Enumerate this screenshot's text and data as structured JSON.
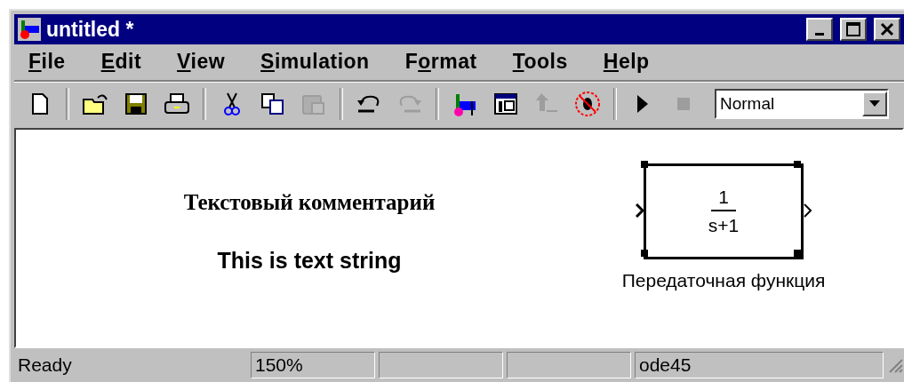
{
  "window": {
    "title": "untitled *"
  },
  "menu": [
    {
      "mnemonic": "F",
      "after": "ile"
    },
    {
      "mnemonic": "E",
      "after": "dit"
    },
    {
      "mnemonic": "V",
      "after": "iew"
    },
    {
      "mnemonic": "S",
      "after": "imulation"
    },
    {
      "before": "F",
      "mnemonic": "o",
      "after": "rmat"
    },
    {
      "mnemonic": "T",
      "after": "ools"
    },
    {
      "mnemonic": "H",
      "after": "elp"
    }
  ],
  "toolbar": [
    {
      "kind": "new",
      "disabled": false
    },
    {
      "kind": "sep"
    },
    {
      "kind": "open",
      "disabled": false
    },
    {
      "kind": "save",
      "disabled": false
    },
    {
      "kind": "print",
      "disabled": false
    },
    {
      "kind": "sep"
    },
    {
      "kind": "cut",
      "disabled": false
    },
    {
      "kind": "copy",
      "disabled": false
    },
    {
      "kind": "paste",
      "disabled": true
    },
    {
      "kind": "sep"
    },
    {
      "kind": "undo",
      "disabled": false
    },
    {
      "kind": "redo",
      "disabled": true
    },
    {
      "kind": "sep"
    },
    {
      "kind": "library",
      "disabled": false
    },
    {
      "kind": "browser",
      "disabled": false
    },
    {
      "kind": "parent",
      "disabled": true
    },
    {
      "kind": "debug",
      "disabled": false
    },
    {
      "kind": "sep"
    },
    {
      "kind": "start",
      "disabled": false
    },
    {
      "kind": "stop",
      "disabled": true
    }
  ],
  "mode_select": {
    "value": "Normal"
  },
  "canvas": {
    "annotations": [
      {
        "kind": "serif",
        "text": "Текстовый комментарий"
      },
      {
        "kind": "sans",
        "text": "This is text string"
      }
    ],
    "block": {
      "numerator": "1",
      "denominator": "s+1",
      "label": "Передаточная функция",
      "selected": true
    }
  },
  "status_bar": {
    "message": "Ready",
    "zoom": "150%",
    "solver": "ode45"
  }
}
